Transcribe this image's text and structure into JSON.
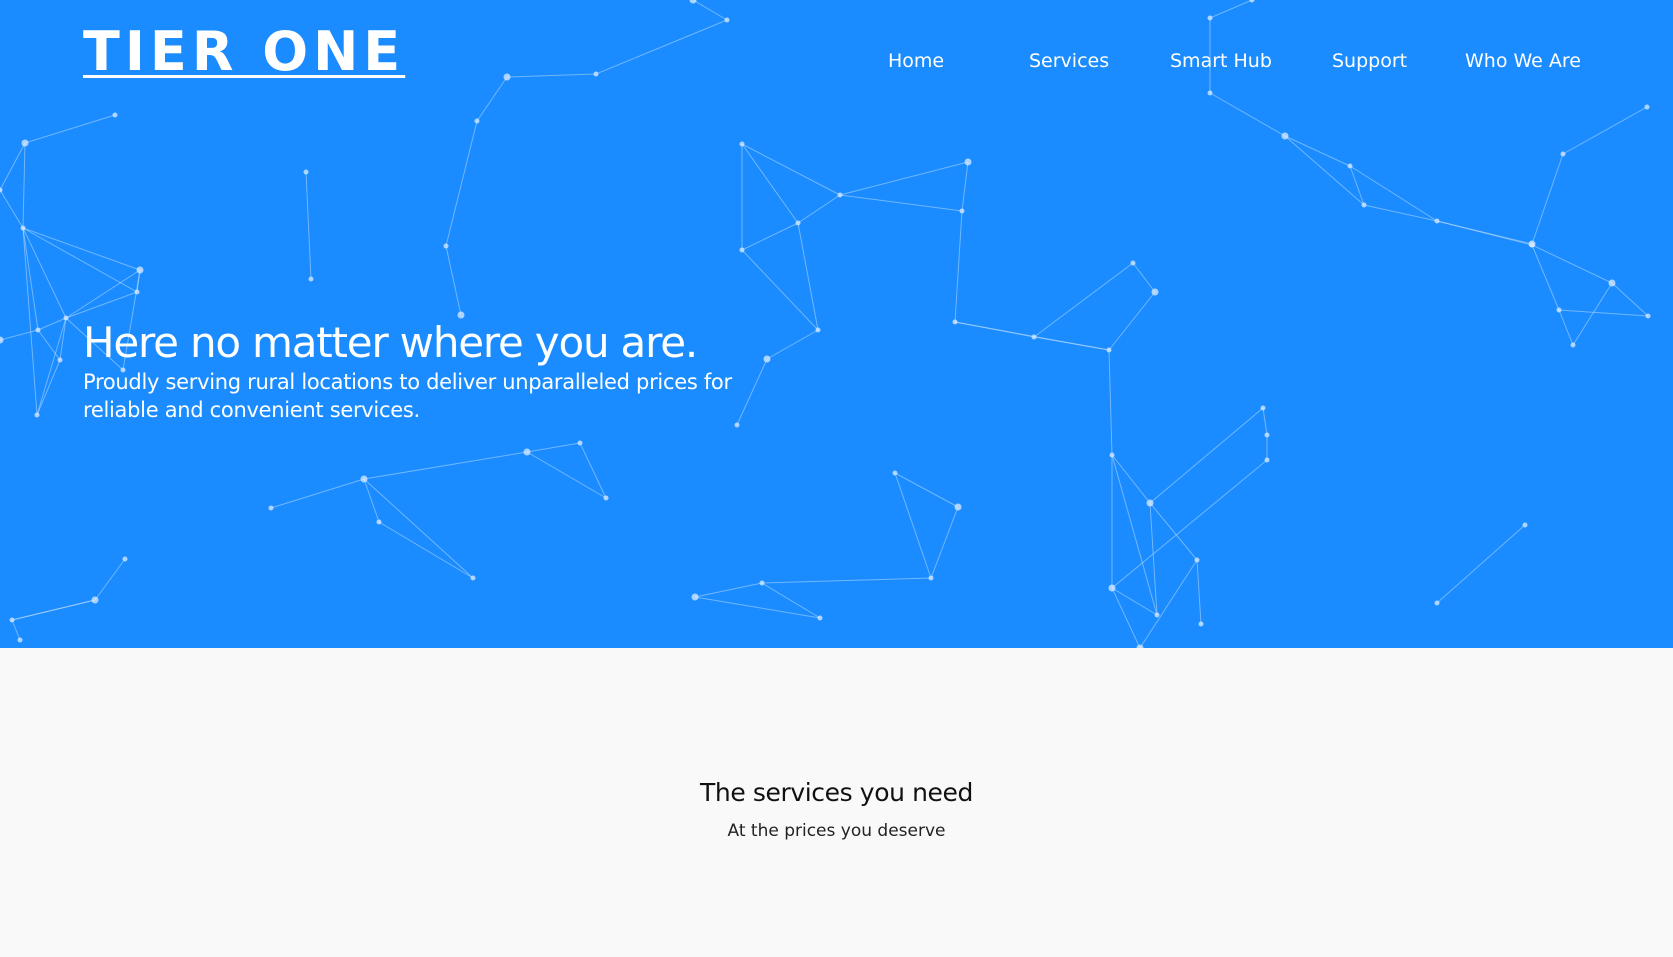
{
  "brand": {
    "logo_text": "TIER ONE",
    "hero_color": "#1a8cff"
  },
  "nav": {
    "items": [
      {
        "label": "Home"
      },
      {
        "label": "Services"
      },
      {
        "label": "Smart Hub"
      },
      {
        "label": "Support"
      },
      {
        "label": "Who We Are"
      }
    ]
  },
  "hero": {
    "heading": "Here no matter where you are.",
    "subheading": "Proudly serving rural locations to deliver unparalleled prices for reliable and convenient services."
  },
  "services": {
    "title": "The services you need",
    "subtitle": "At the prices you deserve"
  }
}
